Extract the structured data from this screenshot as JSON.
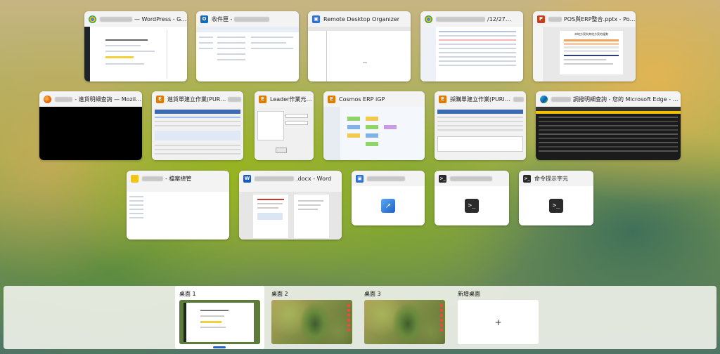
{
  "windows": [
    {
      "title": "— WordPress - G…",
      "icon": "chrome-icon",
      "app_color": "#e34133"
    },
    {
      "title": "收件匣 -",
      "icon": "outlook-icon",
      "app_color": "#0f6cbd"
    },
    {
      "title": "Remote Desktop Organizer",
      "icon": "remote-desktop-icon",
      "app_color": "#2f6fd1"
    },
    {
      "title": "/12/27…",
      "icon": "chrome-icon",
      "app_color": "#e34133"
    },
    {
      "title": "POS與ERP整合.pptx - Pow…",
      "icon": "powerpoint-icon",
      "app_color": "#c43e1c"
    },
    {
      "title": "- 進貨明細查詢 — Mozilla Fir…",
      "icon": "firefox-icon",
      "app_color": "#e66000"
    },
    {
      "title": "進貨單建立作業(PURI09",
      "icon": "erp-window-icon",
      "app_color": "#e07b00"
    },
    {
      "title": "Leader作業元件中心",
      "icon": "erp-window-icon",
      "app_color": "#e07b00"
    },
    {
      "title": "Cosmos ERP iGP",
      "icon": "erp-window-icon",
      "app_color": "#e07b00"
    },
    {
      "title": "採購單建立作業(PURI07)",
      "icon": "erp-window-icon",
      "app_color": "#e07b00"
    },
    {
      "title": "調撥明細查詢 - 您的 Microsoft Edge - Microsoft…",
      "icon": "edge-icon",
      "app_color": "#1b9de2"
    },
    {
      "title": "- 檔案總管",
      "icon": "folder-icon",
      "app_color": "#f2c318"
    },
    {
      "title": ".docx - Word",
      "icon": "word-icon",
      "app_color": "#185abd"
    },
    {
      "title": "",
      "icon": "remote-desktop-icon",
      "app_color": "#2f6fd1"
    },
    {
      "title": "",
      "icon": "terminal-icon",
      "app_color": "#2b2b2b"
    },
    {
      "title": "命令提示字元",
      "icon": "terminal-icon",
      "app_color": "#2b2b2b"
    }
  ],
  "thumb_texts": {
    "ppt_heading": "本地方案與其他方案的優勢",
    "cmd_prompt": ">_"
  },
  "desktops": [
    {
      "label": "桌面 1",
      "selected": true
    },
    {
      "label": "桌面 2",
      "selected": false
    },
    {
      "label": "桌面 3",
      "selected": false
    },
    {
      "label": "新增桌面",
      "selected": false,
      "add_symbol": "+"
    }
  ]
}
